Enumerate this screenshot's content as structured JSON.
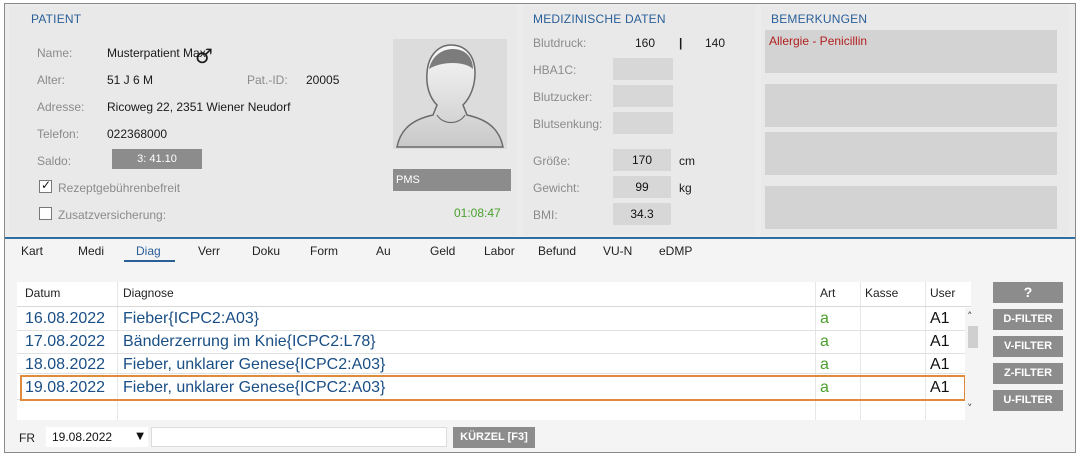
{
  "patient": {
    "title": "PATIENT",
    "name_label": "Name:",
    "name": "Musterpatient Max",
    "alter_label": "Alter:",
    "alter": "51 J 6 M",
    "gender_symbol": "♂",
    "patid_label": "Pat.-ID:",
    "patid": "20005",
    "adresse_label": "Adresse:",
    "adresse": "Ricoweg 22, 2351 Wiener Neudorf",
    "telefon_label": "Telefon:",
    "telefon": "022368000",
    "saldo_label": "Saldo:",
    "saldo": "3: 41.10",
    "rezept_label": "Rezeptgebührenbefreit",
    "rezept_checked": true,
    "zusatz_label": "Zusatzversicherung:",
    "zusatz_checked": false,
    "pms": "PMS",
    "timer": "01:08:47"
  },
  "medical": {
    "title": "MEDIZINISCHE DATEN",
    "blutdruck_label": "Blutdruck:",
    "blutdruck_sys": "160",
    "blutdruck_sep": "|",
    "blutdruck_dia": "140",
    "hba1c_label": "HBA1C:",
    "blutzucker_label": "Blutzucker:",
    "blutsenkung_label": "Blutsenkung:",
    "groesse_label": "Größe:",
    "groesse": "170",
    "groesse_unit": "cm",
    "gewicht_label": "Gewicht:",
    "gewicht": "99",
    "gewicht_unit": "kg",
    "bmi_label": "BMI:",
    "bmi": "34.3"
  },
  "remarks": {
    "title": "BEMERKUNGEN",
    "items": [
      "Allergie - Penicillin",
      "",
      "",
      ""
    ]
  },
  "tabs": [
    "Kart",
    "Medi",
    "Diag",
    "Verr",
    "Doku",
    "Form",
    "Au",
    "Geld",
    "Labor",
    "Befund",
    "VU-N",
    "eDMP"
  ],
  "active_tab": "Diag",
  "table": {
    "headers": {
      "datum": "Datum",
      "diagnose": "Diagnose",
      "art": "Art",
      "kasse": "Kasse",
      "user": "User"
    },
    "rows": [
      {
        "datum": "16.08.2022",
        "diagnose": "Fieber{ICPC2:A03}",
        "art": "a",
        "kasse": "",
        "user": "A1"
      },
      {
        "datum": "17.08.2022",
        "diagnose": "Bänderzerrung im Knie{ICPC2:L78}",
        "art": "a",
        "kasse": "",
        "user": "A1"
      },
      {
        "datum": "18.08.2022",
        "diagnose": "Fieber, unklarer Genese{ICPC2:A03}",
        "art": "a",
        "kasse": "",
        "user": "A1"
      },
      {
        "datum": "19.08.2022",
        "diagnose": "Fieber, unklarer Genese{ICPC2:A03}",
        "art": "a",
        "kasse": "",
        "user": "A1"
      }
    ]
  },
  "filters": {
    "help": "?",
    "d": "D-FILTER",
    "v": "V-FILTER",
    "z": "Z-FILTER",
    "u": "U-FILTER"
  },
  "bottom": {
    "fr_label": "FR",
    "date": "19.08.2022",
    "input_value": "",
    "kuerzel": "KÜRZEL [F3]"
  },
  "colors": {
    "accent": "#2a5f98",
    "highlight": "#e08a3c",
    "art_green": "#4aa02c",
    "warning_red": "#b21f1f"
  }
}
